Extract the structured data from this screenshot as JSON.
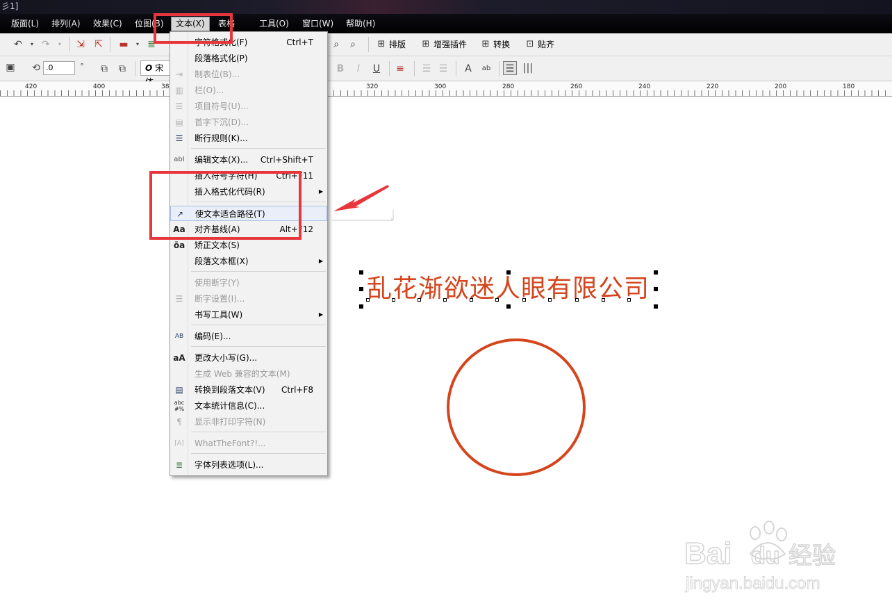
{
  "window": {
    "title_fragment": "彡1]"
  },
  "menubar": {
    "items": [
      {
        "label": "版面(L)"
      },
      {
        "label": "排列(A)"
      },
      {
        "label": "效果(C)"
      },
      {
        "label": "位图(B)"
      },
      {
        "label": "文本(X)"
      },
      {
        "label": "表格"
      },
      {
        "label": "工具(O)"
      },
      {
        "label": "窗口(W)"
      },
      {
        "label": "帮助(H)"
      }
    ],
    "active_item": "文本(X)"
  },
  "toolbar1": {
    "buttons": [
      {
        "label": "排版"
      },
      {
        "label": "增强插件"
      },
      {
        "label": "转换"
      },
      {
        "label": "贴齐"
      }
    ]
  },
  "toolbar2": {
    "rotation_value": ".0",
    "rotation_unit": "°",
    "font_name": "宋体"
  },
  "ruler": {
    "labels": [
      "420",
      "400",
      "380",
      "320",
      "300",
      "280",
      "260",
      "240",
      "220",
      "200",
      "180"
    ]
  },
  "text_menu": {
    "items": [
      {
        "label": "字符格式化(F)",
        "shortcut": "Ctrl+T",
        "icon": "char-format-icon",
        "disabled": false
      },
      {
        "label": "段落格式化(P)",
        "shortcut": "",
        "icon": "",
        "disabled": false
      },
      {
        "label": "制表位(B)...",
        "shortcut": "",
        "icon": "tab-stop-icon",
        "disabled": true
      },
      {
        "label": "栏(O)...",
        "shortcut": "",
        "icon": "columns-icon",
        "disabled": true
      },
      {
        "label": "项目符号(U)...",
        "shortcut": "",
        "icon": "bullets-icon",
        "disabled": true
      },
      {
        "label": "首字下沉(D)...",
        "shortcut": "",
        "icon": "drop-cap-icon",
        "disabled": true
      },
      {
        "label": "断行规则(K)...",
        "shortcut": "",
        "icon": "line-break-icon",
        "disabled": false
      },
      {
        "label": "编辑文本(X)...",
        "shortcut": "Ctrl+Shift+T",
        "icon": "edit-text-icon",
        "disabled": false
      },
      {
        "label": "插入符号字符(H)",
        "shortcut": "Ctrl+F11",
        "icon": "",
        "disabled": false
      },
      {
        "label": "插入格式化代码(R)",
        "shortcut": "",
        "icon": "",
        "disabled": false,
        "submenu": true
      },
      {
        "label": "使文本适合路径(T)",
        "shortcut": "",
        "icon": "fit-text-path-icon",
        "disabled": false,
        "highlight": true
      },
      {
        "label": "对齐基线(A)",
        "shortcut": "Alt+F12",
        "icon": "align-baseline-icon",
        "disabled": false
      },
      {
        "label": "矫正文本(S)",
        "shortcut": "",
        "icon": "straighten-text-icon",
        "disabled": false
      },
      {
        "label": "段落文本框(X)",
        "shortcut": "",
        "icon": "",
        "disabled": false,
        "submenu": true
      },
      {
        "label": "使用断字(Y)",
        "shortcut": "",
        "icon": "",
        "disabled": true
      },
      {
        "label": "断字设置(I)...",
        "shortcut": "",
        "icon": "hyphen-settings-icon",
        "disabled": true
      },
      {
        "label": "书写工具(W)",
        "shortcut": "",
        "icon": "",
        "disabled": false,
        "submenu": true
      },
      {
        "label": "编码(E)...",
        "shortcut": "",
        "icon": "encoding-icon",
        "disabled": false
      },
      {
        "label": "更改大小写(G)...",
        "shortcut": "",
        "icon": "change-case-icon",
        "disabled": false
      },
      {
        "label": "生成 Web 兼容的文本(M)",
        "shortcut": "",
        "icon": "",
        "disabled": true
      },
      {
        "label": "转换到段落文本(V)",
        "shortcut": "Ctrl+F8",
        "icon": "convert-paragraph-icon",
        "disabled": false
      },
      {
        "label": "文本统计信息(C)...",
        "shortcut": "",
        "icon": "text-stats-icon",
        "disabled": false
      },
      {
        "label": "显示非打印字符(N)",
        "shortcut": "",
        "icon": "pilcrow-icon",
        "disabled": true
      },
      {
        "label": "WhatTheFont?!...",
        "shortcut": "",
        "icon": "whatthefont-icon",
        "disabled": true
      },
      {
        "label": "字体列表选项(L)...",
        "shortcut": "",
        "icon": "font-list-icon",
        "disabled": false
      }
    ]
  },
  "canvas": {
    "text": "乱花渐欲迷人眼有限公司",
    "text_color": "#d4451d",
    "circle_color": "#d4451d"
  },
  "watermark": {
    "brand": "Bai",
    "brand2": "du",
    "suffix": "经验",
    "url": "jingyan.baidu.com"
  },
  "colors": {
    "highlight_red": "#e8373c",
    "menu_bg": "#f2f2f2"
  }
}
